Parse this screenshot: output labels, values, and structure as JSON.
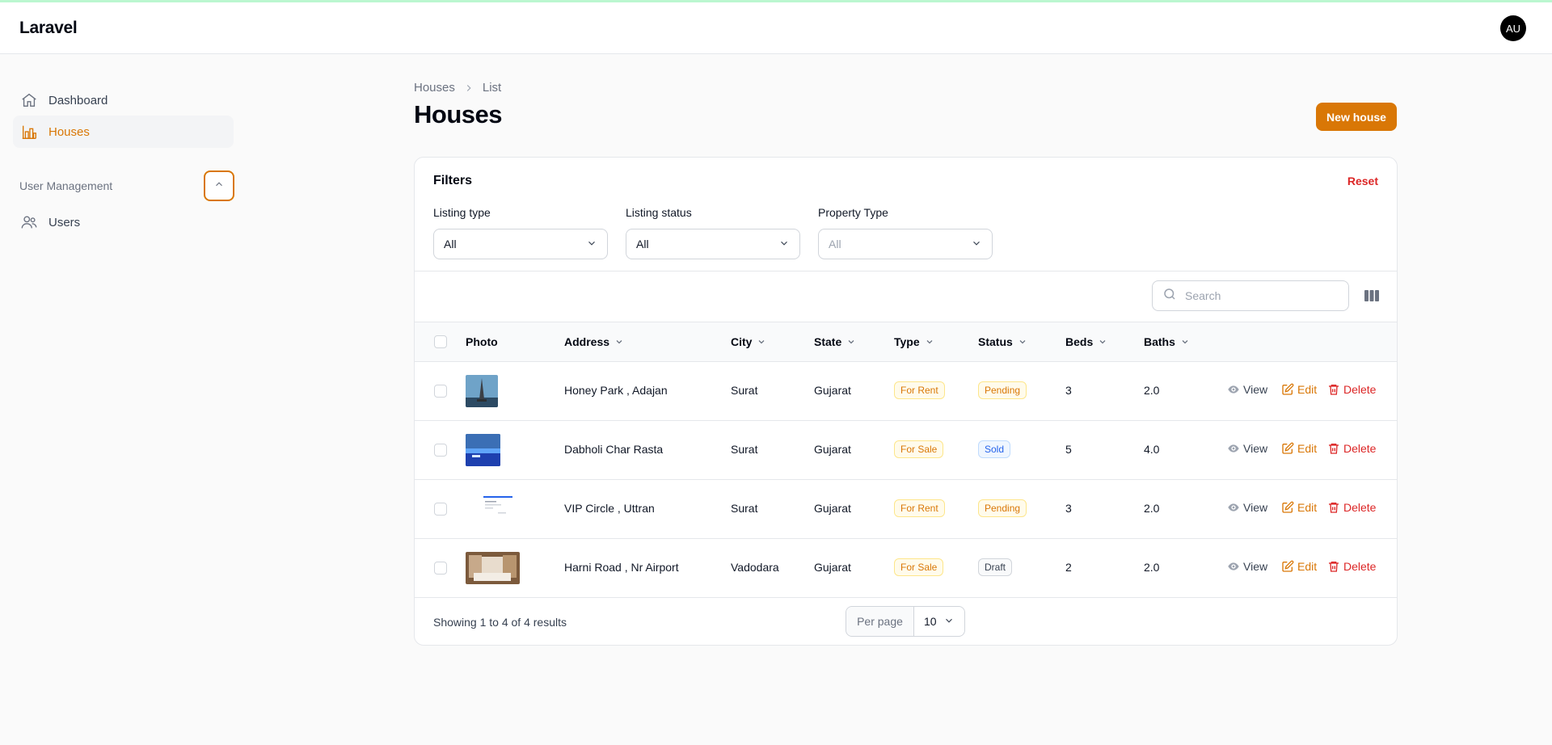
{
  "app": {
    "brand": "Laravel",
    "user_initials": "AU"
  },
  "sidebar": {
    "items": [
      {
        "label": "Dashboard",
        "icon": "home-icon"
      },
      {
        "label": "Houses",
        "icon": "chart-building-icon",
        "active": true
      }
    ],
    "group": {
      "label": "User Management",
      "items": [
        {
          "label": "Users",
          "icon": "users-icon"
        }
      ]
    }
  },
  "breadcrumb": [
    "Houses",
    "List"
  ],
  "page": {
    "title": "Houses",
    "new_button": "New house"
  },
  "filters": {
    "title": "Filters",
    "reset": "Reset",
    "listing_type": {
      "label": "Listing type",
      "value": "All"
    },
    "listing_status": {
      "label": "Listing status",
      "value": "All"
    },
    "property_type": {
      "label": "Property Type",
      "value": "All"
    }
  },
  "search": {
    "placeholder": "Search"
  },
  "table": {
    "columns": [
      "Photo",
      "Address",
      "City",
      "State",
      "Type",
      "Status",
      "Beds",
      "Baths"
    ],
    "rows": [
      {
        "address": "Honey Park , Adajan",
        "city": "Surat",
        "state": "Gujarat",
        "type": "For Rent",
        "status": "Pending",
        "beds": "3",
        "baths": "2.0"
      },
      {
        "address": "Dabholi Char Rasta",
        "city": "Surat",
        "state": "Gujarat",
        "type": "For Sale",
        "status": "Sold",
        "beds": "5",
        "baths": "4.0"
      },
      {
        "address": "VIP Circle , Uttran",
        "city": "Surat",
        "state": "Gujarat",
        "type": "For Rent",
        "status": "Pending",
        "beds": "3",
        "baths": "2.0"
      },
      {
        "address": "Harni Road , Nr Airport",
        "city": "Vadodara",
        "state": "Gujarat",
        "type": "For Sale",
        "status": "Draft",
        "beds": "2",
        "baths": "2.0"
      }
    ],
    "actions": {
      "view": "View",
      "edit": "Edit",
      "delete": "Delete"
    }
  },
  "pagination": {
    "summary": "Showing 1 to 4 of 4 results",
    "per_page_label": "Per page",
    "per_page_value": "10"
  },
  "colors": {
    "accent": "#d97706",
    "danger": "#dc2626",
    "info": "#2563eb"
  }
}
